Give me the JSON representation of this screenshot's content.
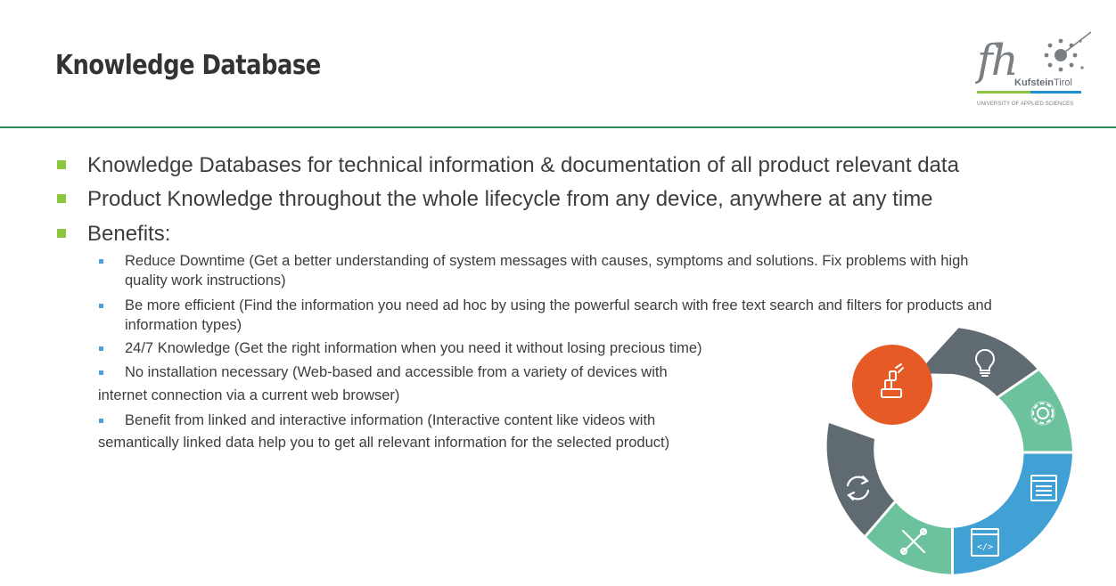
{
  "header": {
    "title": "Knowledge Database",
    "logo": {
      "mark": "fh",
      "name_bold": "Kufstein",
      "name_light": "Tirol",
      "tagline": "UNIVERSITY OF APPLIED SCIENCES"
    }
  },
  "bullets": [
    "Knowledge Databases for technical information & documentation of all product relevant data",
    "Product Knowledge throughout the whole lifecycle from any device, anywhere at any time",
    "Benefits:"
  ],
  "benefits": [
    {
      "line1": "Reduce Downtime (Get a better understanding of system messages with causes, symptoms and solutions. Fix problems with high",
      "line2": "quality work instructions)"
    },
    {
      "line1": "Be more efficient (Find the information you need ad hoc by using the powerful search with free text search and filters for products and",
      "line2": "information types)"
    },
    {
      "line1": "24/7 Knowledge (Get the right information when you need it without losing precious time)",
      "line2": ""
    },
    {
      "line1": "No installation necessary (Web-based and accessible from a variety of devices with",
      "line2": "internet connection via a current web browser)"
    },
    {
      "line1": "Benefit from linked and interactive information (Interactive content like videos with",
      "line2": "semantically linked data help you to get all relevant information for the selected product)"
    }
  ],
  "graphic": {
    "colors": {
      "gray": "#5f6b71",
      "green": "#6cc29d",
      "blue": "#42a1d4",
      "orange": "#e65a25",
      "bullet_green": "#8dc63f",
      "bullet_blue": "#4aa3d8",
      "rule": "#2f8a5a"
    },
    "segments": [
      {
        "icon": "lightbulb-icon",
        "color": "gray"
      },
      {
        "icon": "gear-icon",
        "color": "green"
      },
      {
        "icon": "list-document-icon",
        "color": "blue"
      },
      {
        "icon": "code-window-icon",
        "color": "blue"
      },
      {
        "icon": "tools-icon",
        "color": "green"
      },
      {
        "icon": "refresh-icon",
        "color": "gray"
      }
    ],
    "center_icon": "robot-arm-icon"
  }
}
